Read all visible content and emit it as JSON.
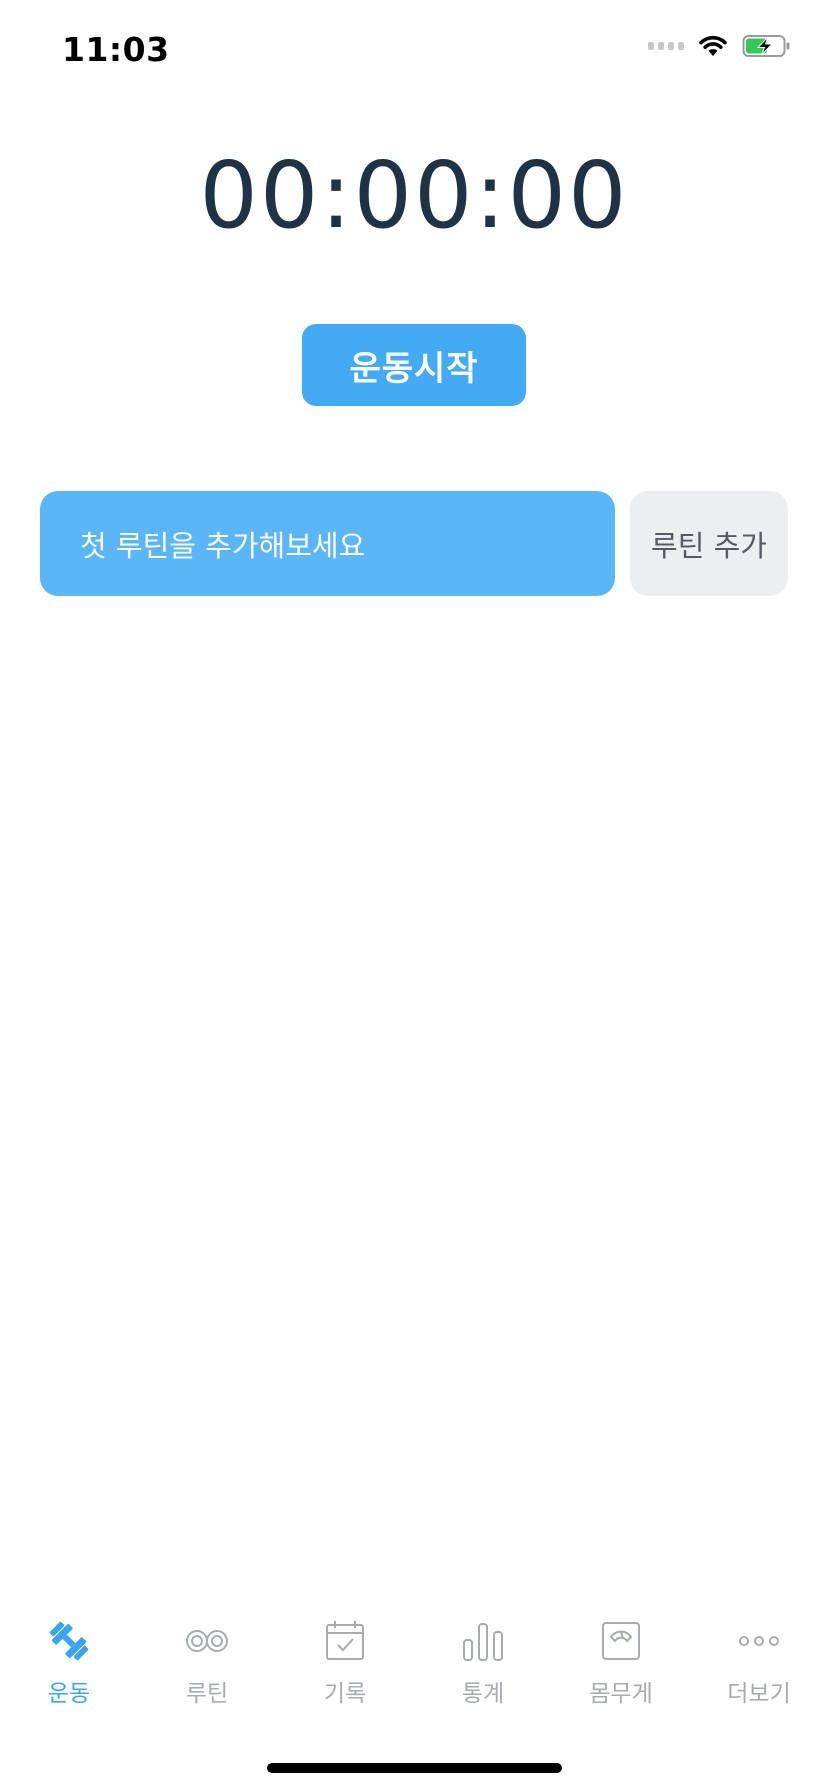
{
  "status_bar": {
    "time": "11:03",
    "icons": [
      "cellular-signal-icon",
      "wifi-icon",
      "battery-charging-icon"
    ]
  },
  "timer": {
    "display": "00:00:00"
  },
  "start_button": {
    "label": "운동시작"
  },
  "routine": {
    "placeholder_card": "첫 루틴을 추가해보세요",
    "add_button": "루틴 추가"
  },
  "tab_bar": {
    "active_index": 0,
    "active_color": "#3aa4ef",
    "inactive_color": "#a7abaf",
    "tabs": [
      {
        "label": "운동",
        "icon": "dumbbell-icon"
      },
      {
        "label": "루틴",
        "icon": "infinity-icon"
      },
      {
        "label": "기록",
        "icon": "calendar-check-icon"
      },
      {
        "label": "통계",
        "icon": "bar-chart-icon"
      },
      {
        "label": "몸무게",
        "icon": "scale-icon"
      },
      {
        "label": "더보기",
        "icon": "more-dots-icon"
      }
    ]
  },
  "colors": {
    "primary_blue": "#43aaf3",
    "card_blue": "#5bb6f8",
    "timer_text": "#1f3347",
    "secondary_button_bg": "#eceef0"
  }
}
